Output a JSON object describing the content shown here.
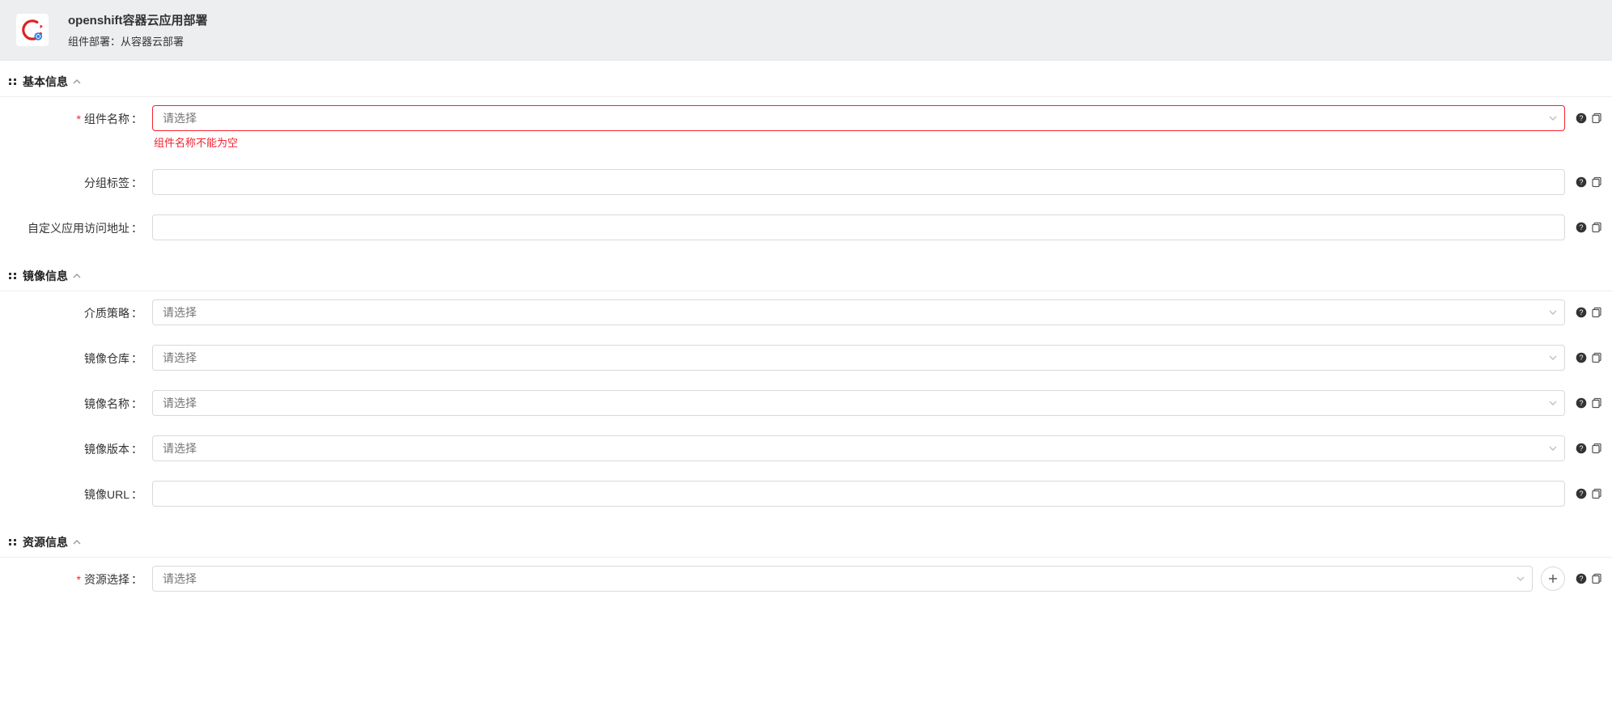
{
  "header": {
    "title": "openshift容器云应用部署",
    "subtitle": "组件部署：从容器云部署"
  },
  "common": {
    "select_placeholder": "请选择"
  },
  "sections": {
    "basic": {
      "title": "基本信息"
    },
    "image": {
      "title": "镜像信息"
    },
    "resource": {
      "title": "资源信息"
    }
  },
  "fields": {
    "component_name": {
      "label": "组件名称",
      "required": true,
      "error": "组件名称不能为空"
    },
    "group_tag": {
      "label": "分组标签",
      "required": false
    },
    "custom_access_url": {
      "label": "自定义应用访问地址",
      "required": false
    },
    "media_strategy": {
      "label": "介质策略",
      "required": false
    },
    "image_repo": {
      "label": "镜像仓库",
      "required": false
    },
    "image_name": {
      "label": "镜像名称",
      "required": false
    },
    "image_version": {
      "label": "镜像版本",
      "required": false
    },
    "image_url": {
      "label": "镜像URL",
      "required": false
    },
    "resource_select": {
      "label": "资源选择",
      "required": true
    }
  }
}
